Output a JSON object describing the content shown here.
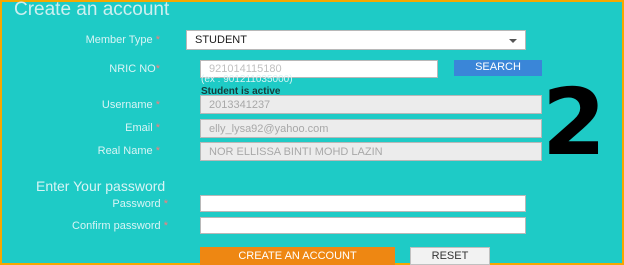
{
  "form": {
    "title": "Create an account",
    "member_type": {
      "label": "Member Type",
      "value": "STUDENT"
    },
    "nric": {
      "label": "NRIC NO",
      "value": "921014115180",
      "hint": "(ex : 901211035000)",
      "status": "Student is active"
    },
    "search_label": "SEARCH",
    "username": {
      "label": "Username",
      "value": "2013341237"
    },
    "email": {
      "label": "Email",
      "value": "elly_lysa92@yahoo.com"
    },
    "realname": {
      "label": "Real Name",
      "value": "NOR ELLISSA BINTI MOHD LAZIN"
    },
    "password_section": "Enter Your password",
    "password": {
      "label": "Password",
      "value": ""
    },
    "confirm": {
      "label": "Confirm password",
      "value": ""
    },
    "create_label": "CREATE AN ACCOUNT",
    "reset_label": "RESET",
    "required_mark": "*"
  },
  "annotation": {
    "step": "2"
  },
  "colors": {
    "background": "#1ecbc6",
    "frame": "#f5a800",
    "search_button": "#3a86d8",
    "create_button": "#ee8712"
  }
}
